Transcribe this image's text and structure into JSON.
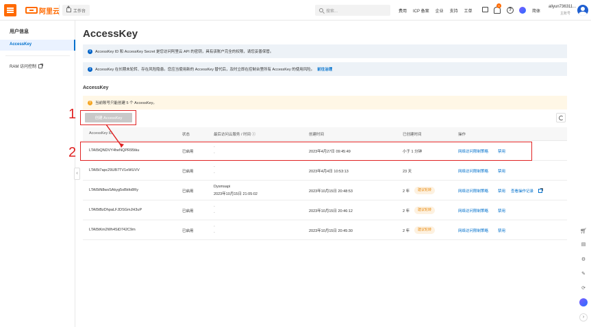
{
  "topbar": {
    "brand": "阿里云",
    "workbench": "工作台",
    "search_placeholder": "搜索...",
    "nav": [
      "费用",
      "ICP 备案",
      "企业",
      "支持",
      "工单"
    ],
    "bell_count": "9",
    "lang": "简体",
    "user_name": "aliyun736311...",
    "user_sub": "主账号"
  },
  "sidebar": {
    "title": "用户信息",
    "active_item": "AccessKey",
    "ram_item": "RAM 访问控制"
  },
  "main": {
    "title": "AccessKey",
    "notice1": "AccessKey ID 和 AccessKey Secret 是您访问阿里云 API 的密钥，具有该账户完全的权限，请您妥善保管。",
    "notice2": "AccessKey 在长期未轮转、存在风险隐患。您应当使用新的 AccessKey 替代后，及时立即在控制台里所有 AccessKey 的使用风险。",
    "notice2_link": "前往治理",
    "section": "AccessKey",
    "warn": "当前账号只能创建 5 个 AccessKey。",
    "create_button": "创建 AccessKey"
  },
  "table": {
    "headers": [
      "AccessKey ID",
      "状态",
      "最后访问云服务 / 时间 ⓘ",
      "创建时间",
      "已创建时间",
      "操作"
    ],
    "rows": [
      {
        "id": "LTAI5tQNDVY4heNQPR95tku",
        "status": "已启用",
        "last1": "-",
        "last2": "-",
        "created": "2023年4月27日 09:45:49",
        "age": "小于 1 分钟",
        "tag": "",
        "op1": "网络访问限制策略",
        "op2": "禁用",
        "op3": ""
      },
      {
        "id": "LTAI5t7apc29UB7TV1eWUVV",
        "status": "已启用",
        "last1": "-",
        "last2": "-",
        "created": "2023年4月4日 10:53:13",
        "age": "23 天",
        "tag": "",
        "op1": "网络访问限制策略",
        "op2": "禁用",
        "op3": ""
      },
      {
        "id": "LTAI5tN8wsSAkyg5oBkfo8Ry",
        "status": "已启用",
        "last1": "Dysmsapi",
        "last2": "2023年10月15日 21:05:02",
        "created": "2023年10月15日 20:48:53",
        "age": "2 年",
        "tag": "建议轮转",
        "op1": "网络访问限制策略",
        "op2": "禁用",
        "op3": "查看操作记录"
      },
      {
        "id": "LTAI5tBzDhpaLFJDSGmJH3uP",
        "status": "已启用",
        "last1": "-",
        "last2": "-",
        "created": "2023年10月15日 20:46:12",
        "age": "2 年",
        "tag": "建议轮转",
        "op1": "网络访问限制策略",
        "op2": "禁用",
        "op3": ""
      },
      {
        "id": "LTAI5tKm2Wh4SiD742C9m",
        "status": "已启用",
        "last1": "-",
        "last2": "-",
        "created": "2023年10月15日 20:45:30",
        "age": "2 年",
        "tag": "建议轮转",
        "op1": "网络访问限制策略",
        "op2": "禁用",
        "op3": ""
      }
    ]
  },
  "annotations": {
    "one": "1",
    "two": "2"
  },
  "colors": {
    "brand": "#ff6a00",
    "link": "#0070cc",
    "annotation": "#e02020"
  }
}
